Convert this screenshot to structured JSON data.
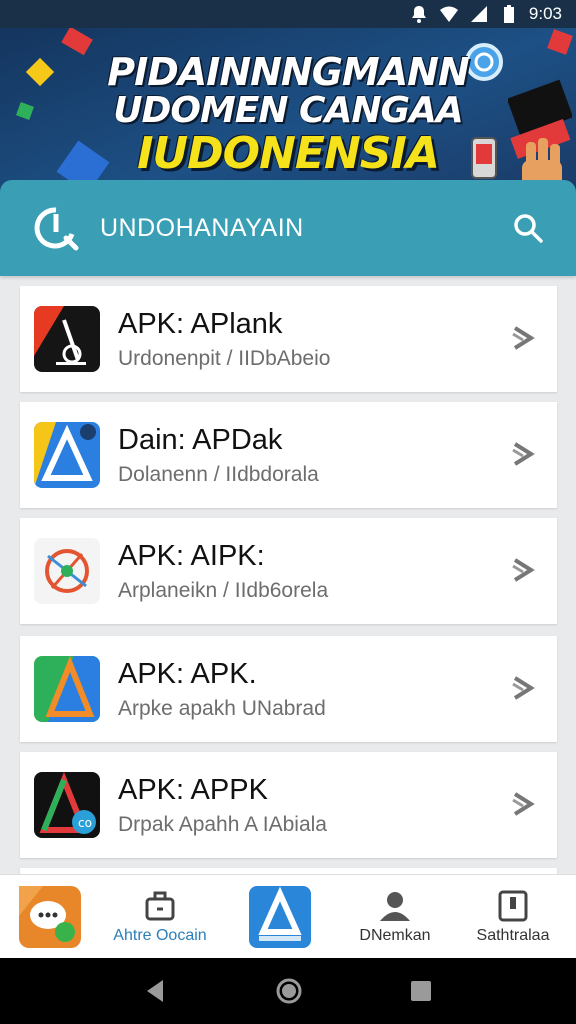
{
  "status_bar": {
    "time": "9:03",
    "icons": [
      "notification-icon",
      "wifi-icon",
      "signal-icon",
      "battery-icon"
    ]
  },
  "banner": {
    "line1": "PIDAINNNGMANN",
    "line2": "UDOMEN CANGAA",
    "line3": "IUDONENSIA"
  },
  "search_header": {
    "title": "UNDOHANAYAIN",
    "logo_icon": "app-logo-icon",
    "search_icon": "search-icon"
  },
  "apps": [
    {
      "name": "APK: APlank",
      "subtitle": "Urdonenpit / IIDbAbeio",
      "icon": "apk-icon-black-red"
    },
    {
      "name": "Dain: APDak",
      "subtitle": "Dolanenn / IIdbdorala",
      "icon": "apk-icon-blue-yellow"
    },
    {
      "name": "APK: AIPK:",
      "subtitle": "Arplaneikn / IIdb6orela",
      "icon": "apk-icon-compass"
    },
    {
      "name": "APK: APK.",
      "subtitle": "Arpke apakh UNabrad",
      "icon": "apk-icon-green-blue"
    },
    {
      "name": "APK: APPK",
      "subtitle": "Drpak Apahh A IAbiala",
      "icon": "apk-icon-black-multicolor"
    }
  ],
  "bottom_nav": [
    {
      "label": "",
      "icon": "chat-app-icon"
    },
    {
      "label": "Ahtre Oocain",
      "icon": "apps-icon",
      "active": true
    },
    {
      "label": "",
      "icon": "store-app-icon"
    },
    {
      "label": "DNemkan",
      "icon": "profile-icon"
    },
    {
      "label": "Sathtralaa",
      "icon": "saved-icon"
    }
  ],
  "colors": {
    "header_teal": "#3a9fb4",
    "banner_navy": "#1d5085",
    "banner_yellow": "#f6e21a",
    "active_nav": "#2a7fb8"
  }
}
